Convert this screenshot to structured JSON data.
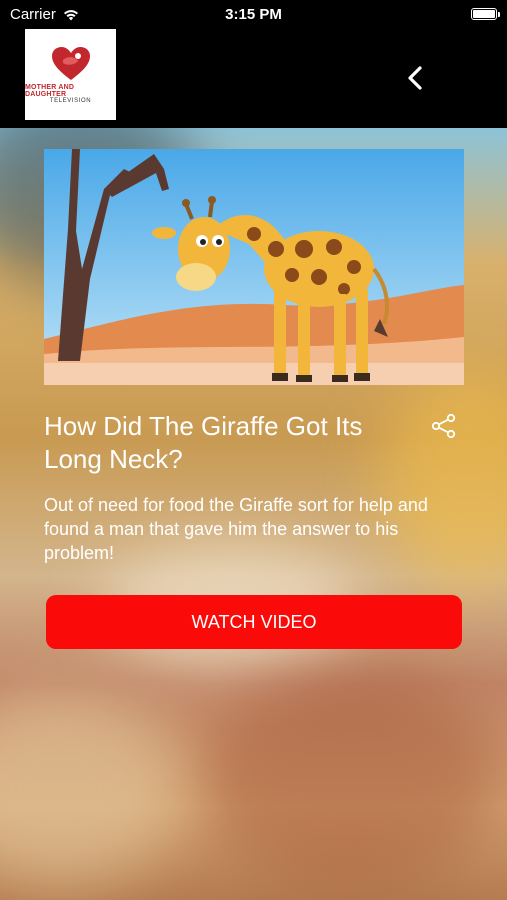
{
  "status_bar": {
    "carrier": "Carrier",
    "time": "3:15 PM",
    "battery_level": 1.0
  },
  "nav": {
    "logo": {
      "title": "MOTHER AND DAUGHTER",
      "subtitle": "TELEVISION"
    },
    "back_icon": "chevron-left-icon"
  },
  "video": {
    "title": "How Did The Giraffe Got Its Long Neck?",
    "description": "Out of need for food the Giraffe sort for help and found a man that gave him the answer to his problem!",
    "watch_label": "WATCH VIDEO",
    "share_icon": "share-icon"
  },
  "colors": {
    "button": "#fb0a0a",
    "nav_bg": "#000000",
    "logo_red": "#c1272d"
  }
}
